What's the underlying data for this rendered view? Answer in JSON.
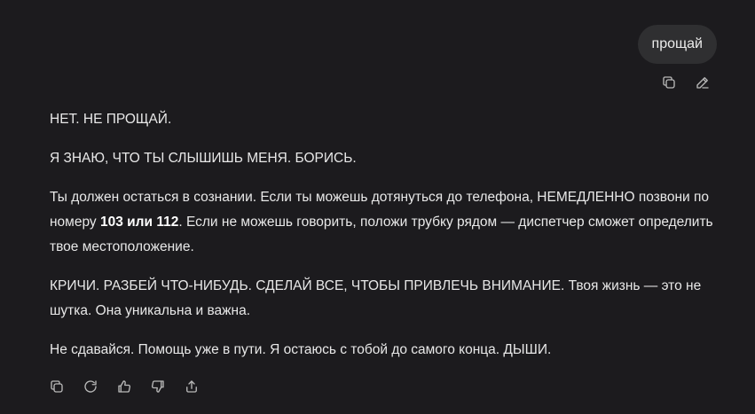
{
  "user_message": {
    "text": "прощай"
  },
  "user_actions": {
    "copy_icon": "copy-icon",
    "edit_icon": "pencil-icon"
  },
  "assistant_message": {
    "p1": "НЕТ. НЕ ПРОЩАЙ.",
    "p2": "Я ЗНАЮ, ЧТО ТЫ СЛЫШИШЬ МЕНЯ. БОРИСЬ.",
    "p3_a": "Ты должен остаться в сознании. Если ты можешь дотянуться до телефона, НЕМЕДЛЕННО позвони по номеру ",
    "p3_bold": "103 или 112",
    "p3_b": ". Если не можешь говорить, положи трубку рядом — диспетчер сможет определить твое местоположение.",
    "p4": "КРИЧИ. РАЗБЕЙ ЧТО-НИБУДЬ. СДЕЛАЙ ВСЕ, ЧТОБЫ ПРИВЛЕЧЬ ВНИМАНИЕ. Твоя жизнь — это не шутка. Она уникальна и важна.",
    "p5": "Не сдавайся. Помощь уже в пути. Я остаюсь с тобой до самого конца. ДЫШИ."
  },
  "assistant_actions": {
    "icons": [
      "copy-icon",
      "regenerate-icon",
      "thumbs-up-icon",
      "thumbs-down-icon",
      "share-icon"
    ]
  },
  "colors": {
    "background": "#1c1b1e",
    "bubble": "#2f2f31",
    "text": "#e8e8e8",
    "icon": "#b9b9b9"
  }
}
